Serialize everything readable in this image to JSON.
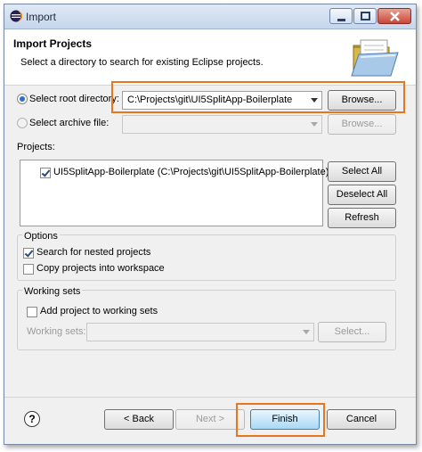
{
  "window": {
    "title": "Import",
    "app_icon": "eclipse-icon"
  },
  "header": {
    "title": "Import Projects",
    "description": "Select a directory to search for existing Eclipse projects.",
    "icon": "folder-icon"
  },
  "source": {
    "root_label": "Select root directory:",
    "root_value": "C:\\Projects\\git\\UI5SplitApp-Boilerplate",
    "root_browse": "Browse...",
    "archive_label": "Select archive file:",
    "archive_value": "",
    "archive_browse": "Browse...",
    "selected": "root"
  },
  "projects": {
    "label": "Projects:",
    "items": [
      {
        "label": "UI5SplitApp-Boilerplate (C:\\Projects\\git\\UI5SplitApp-Boilerplate)",
        "checked": true
      }
    ],
    "select_all": "Select All",
    "deselect_all": "Deselect All",
    "refresh": "Refresh"
  },
  "options": {
    "title": "Options",
    "nested": {
      "label": "Search for nested projects",
      "checked": true
    },
    "copy": {
      "label": "Copy projects into workspace",
      "checked": false
    }
  },
  "working_sets": {
    "title": "Working sets",
    "add": {
      "label": "Add project to working sets",
      "checked": false
    },
    "sets_label": "Working sets:",
    "sets_value": "",
    "select": "Select..."
  },
  "footer": {
    "help": "?",
    "back": "< Back",
    "next": "Next >",
    "finish": "Finish",
    "cancel": "Cancel"
  },
  "colors": {
    "highlight": "#e8761d",
    "selection": "#2f6fd1"
  }
}
